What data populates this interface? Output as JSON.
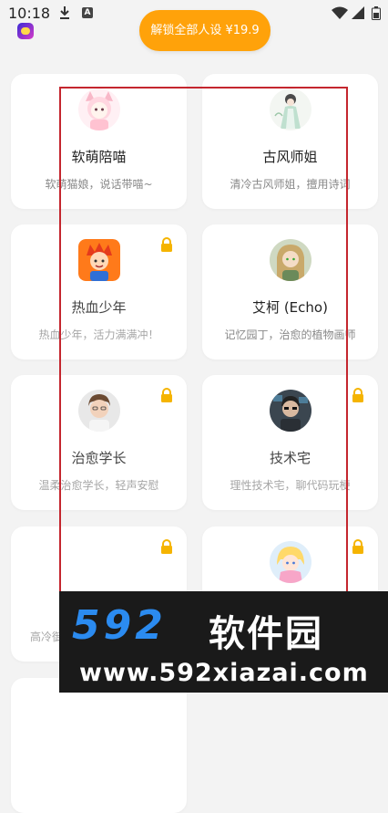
{
  "status_bar": {
    "time": "10:18"
  },
  "header": {
    "unlock_button": "解锁全部人设 ¥19.9"
  },
  "cards": [
    {
      "name": "软萌陪喵",
      "desc": "软萌猫娘，说话带喵~",
      "locked": false,
      "avatar_icon": "catgirl-avatar"
    },
    {
      "name": "古风师姐",
      "desc": "清冷古风师姐，擅用诗词",
      "locked": false,
      "avatar_icon": "ancient-sister-avatar"
    },
    {
      "name": "热血少年",
      "desc": "热血少年，活力满满冲！",
      "locked": true,
      "avatar_icon": "hot-blooded-boy-avatar"
    },
    {
      "name": "艾柯 (Echo)",
      "desc": "记忆园丁，治愈的植物画师",
      "locked": false,
      "avatar_icon": "echo-avatar"
    },
    {
      "name": "治愈学长",
      "desc": "温柔治愈学长，轻声安慰",
      "locked": true,
      "avatar_icon": "senior-avatar"
    },
    {
      "name": "技术宅",
      "desc": "理性技术宅，聊代码玩梗",
      "locked": true,
      "avatar_icon": "tech-geek-avatar"
    },
    {
      "name": "",
      "desc": "高冷御",
      "locked": true,
      "avatar_icon": ""
    },
    {
      "name": "",
      "desc": "",
      "locked": true,
      "avatar_icon": "magical-girl-avatar"
    }
  ],
  "watermark": {
    "logo": "592",
    "cn": "软件园",
    "url": "www.592xiazai.com"
  }
}
